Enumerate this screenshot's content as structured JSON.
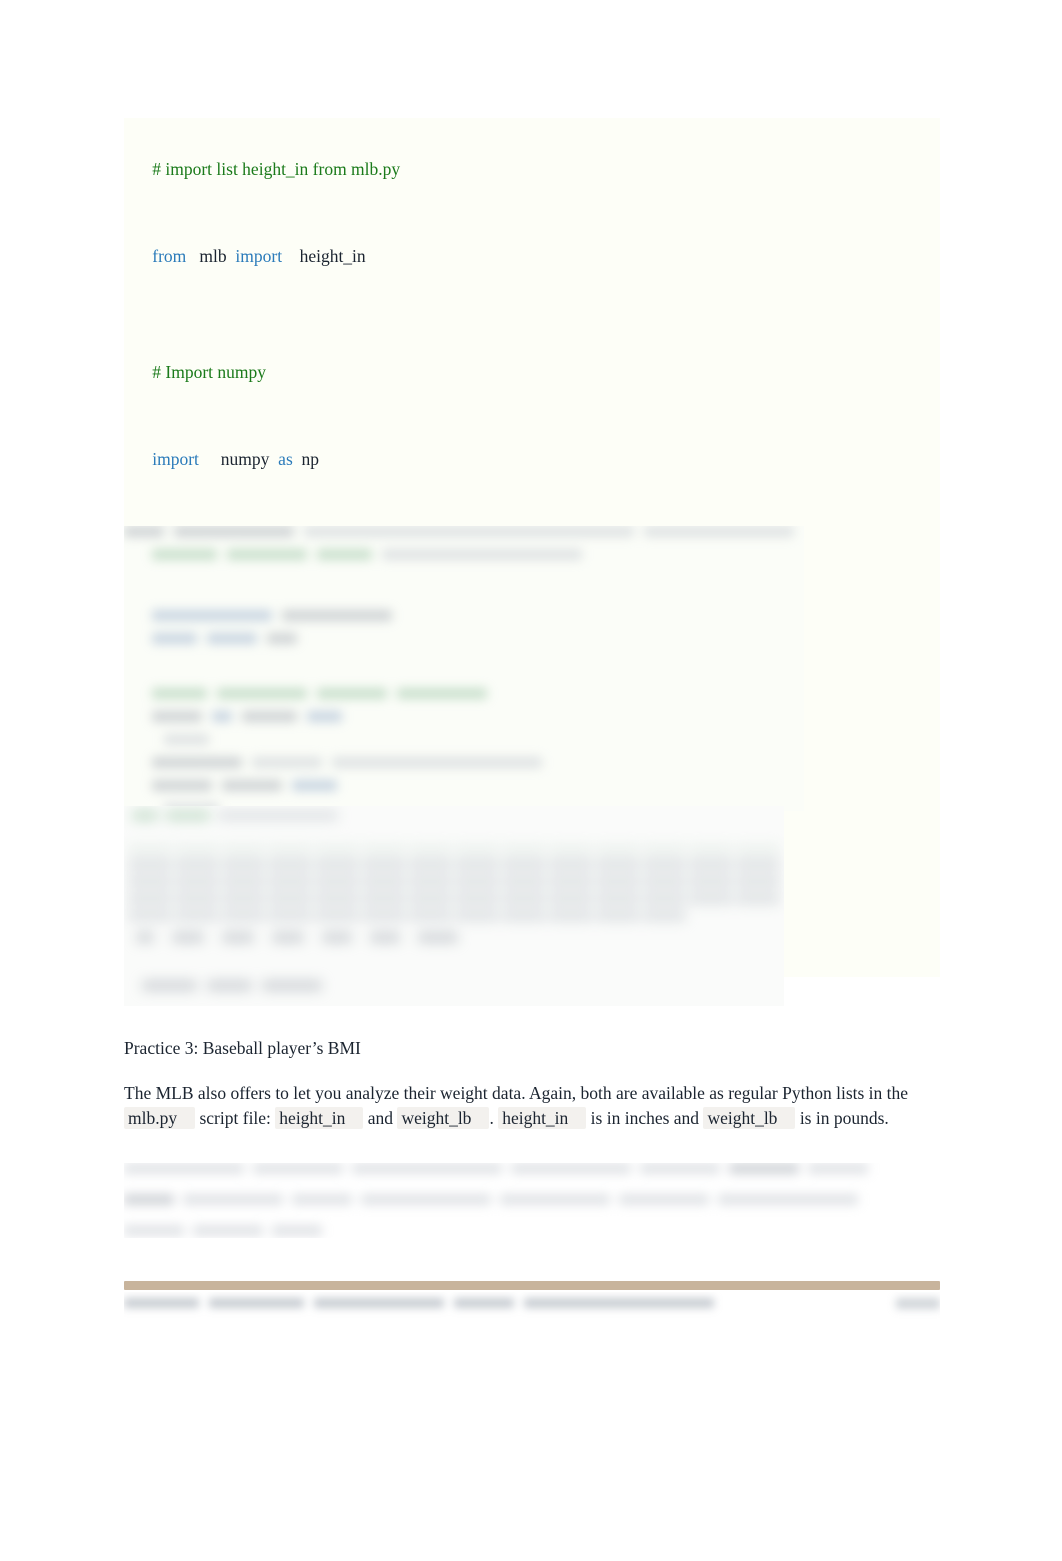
{
  "document": {
    "type": "python-numpy-exercise-worksheet",
    "page_background": "#ffffff",
    "body_text_color": "#1b2430"
  },
  "code_block": {
    "background": "#fdfef7",
    "comment_color": "#1a7a1a",
    "keyword_color": "#2b7bba",
    "identifier_color": "#1b2430",
    "lines": [
      {
        "kind": "comment",
        "text": "# import list height_in from mlb.py"
      },
      {
        "kind": "code",
        "tokens": [
          {
            "t": "from",
            "c": "kw"
          },
          {
            "t": "mlb",
            "c": "id"
          },
          {
            "t": "import",
            "c": "kw"
          },
          {
            "t": "height_in",
            "c": "id"
          }
        ]
      },
      {
        "kind": "blank",
        "text": ""
      },
      {
        "kind": "comment",
        "text": "# Import numpy"
      },
      {
        "kind": "code",
        "tokens": [
          {
            "t": "import",
            "c": "kw"
          },
          {
            "t": "numpy",
            "c": "id"
          },
          {
            "t": "as",
            "c": "kw"
          },
          {
            "t": "np",
            "c": "id"
          }
        ]
      },
      {
        "kind": "blank",
        "text": ""
      },
      {
        "kind": "comment",
        "text": "# Create a numpy array from height_in: np_height_in"
      },
      {
        "kind": "blank",
        "text": ""
      },
      {
        "kind": "comment",
        "text": "# Print out np_height_in"
      },
      {
        "kind": "blank",
        "text": ""
      },
      {
        "kind": "comment",
        "text": "# Convert np_height_in to meters and store the new values in: np_height_m"
      },
      {
        "kind": "blank",
        "text": ""
      },
      {
        "kind": "comment",
        "text": "# Print np_height_m"
      }
    ]
  },
  "redacted": {
    "note": "Two blurred/illegible regions: a code-like listing and a numeric array output table.",
    "code_region_label": "blurred-code-listing",
    "table_region_label": "blurred-array-output",
    "paragraph_label": "blurred-paragraph"
  },
  "practice": {
    "heading": "Practice 3: Baseball player’s BMI",
    "paragraph_part_1": "The MLB also offers to let you analyze their weight data. Again, both are available as regular Python lists in the ",
    "code_mlb": "mlb.py",
    "paragraph_part_2": " script file: ",
    "code_height_in_1": "height_in",
    "paragraph_part_3": " and ",
    "code_weight_lb_1": "weight_lb",
    "paragraph_part_4": ". ",
    "code_height_in_2": "height_in",
    "paragraph_part_5": " is in inches and ",
    "code_weight_lb_2": "weight_lb",
    "paragraph_part_6": " is in pounds."
  },
  "footer": {
    "rule_color": "#c8b49c"
  }
}
